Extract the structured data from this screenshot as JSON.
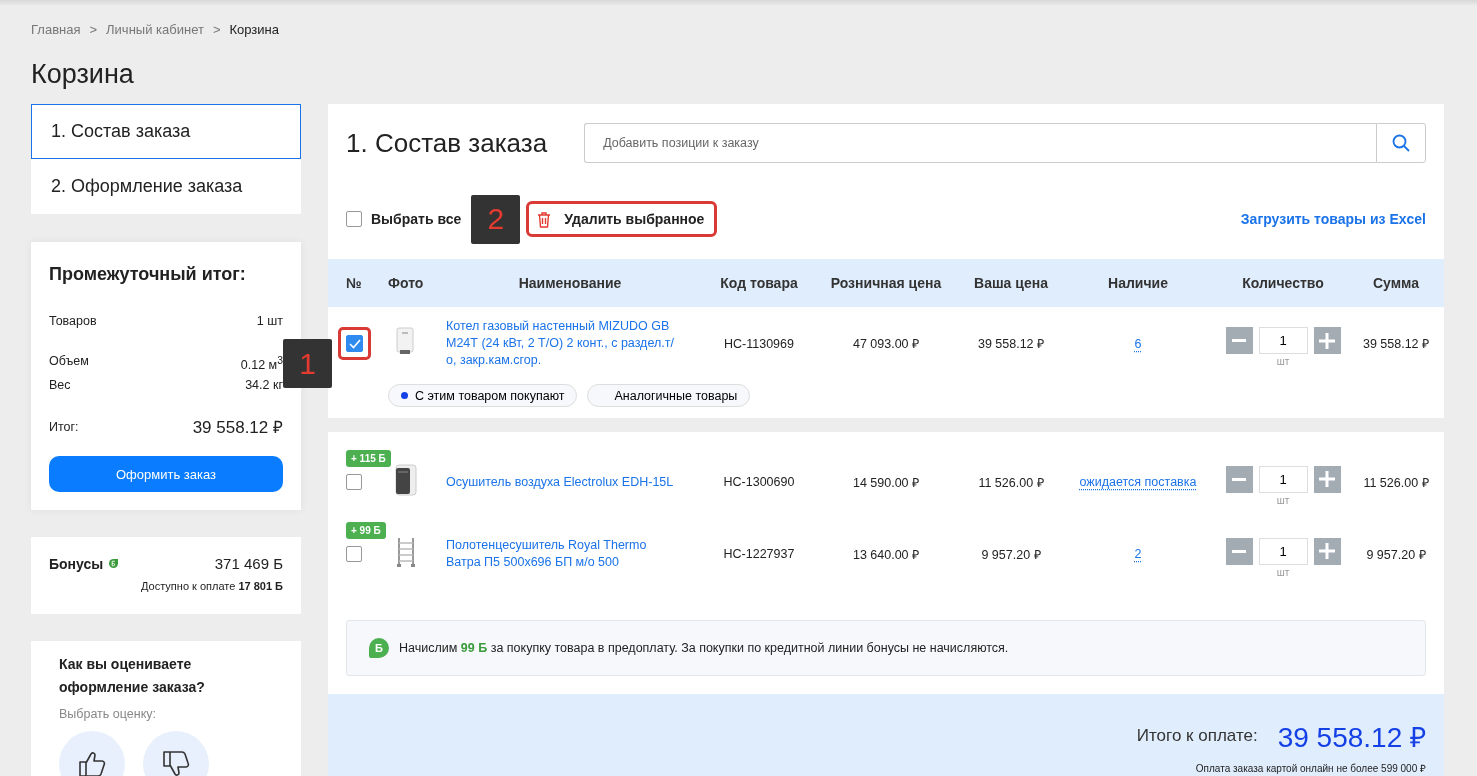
{
  "breadcrumbs": [
    {
      "label": "Главная",
      "current": false
    },
    {
      "label": "Личный кабинет",
      "current": false
    },
    {
      "label": "Корзина",
      "current": true
    }
  ],
  "breadcrumb_separator": ">",
  "page_title": "Корзина",
  "steps": [
    {
      "label": "1. Состав заказа",
      "selected": true
    },
    {
      "label": "2. Оформление заказа",
      "selected": false
    }
  ],
  "summary": {
    "title": "Промежуточный итог:",
    "groups": [
      [
        {
          "label": "Товаров",
          "value": "1 шт"
        }
      ],
      [
        {
          "label": "Объем",
          "value": "0.12 м$^{3}$"
        },
        {
          "label": "Вес",
          "value": "34.2 кг"
        }
      ]
    ],
    "total_label": "Итог:",
    "total_value": "39 558.12 ₽",
    "button": "Оформить заказ"
  },
  "bonuses": {
    "label": "Бонусы",
    "value": "371 469 Б",
    "available": "Доступно к оплате **17 801 Б**"
  },
  "rating": {
    "question": "Как вы оцениваете оформление заказа?",
    "hint": "Выбрать оценку:"
  },
  "order": {
    "title": "1. Состав заказа",
    "search": {
      "placeholder": "Добавить позиции к заказу"
    },
    "select_all": {
      "label": "Выбрать все",
      "checked": false
    },
    "delete_button": {
      "label": "Удалить выбранное",
      "highlighted": true,
      "callout": "2"
    },
    "excel_link": "Загрузить товары из Excel",
    "columns": [
      "№",
      "Фото",
      "Наименование",
      "Код товара",
      "Розничная цена",
      "Ваша цена",
      "Наличие",
      "Количество",
      "Сумма"
    ],
    "groups": [
      {
        "rows": [
          {
            "checked": true,
            "highlighted": true,
            "callout": "1",
            "name": "Котел газовый настенный MIZUDO GB М24Т (24 кВт, 2 Т/О) 2 конт., с раздел.т/о, закр.кам.сгор.",
            "code": "НС-1130969",
            "retail": "47 093.00 ₽",
            "price": "39 558.12 ₽",
            "stock": "6",
            "qty": "1",
            "unit": "шт",
            "sum": "39 558.12 ₽"
          }
        ],
        "chips": [
          {
            "label": "С этим товаром покупают",
            "selected": true
          },
          {
            "label": "Аналогичные товары",
            "selected": false
          }
        ]
      },
      {
        "rows": [
          {
            "checked": false,
            "bonus": "+ 115 Б",
            "name": "Осушитель воздуха Electrolux EDH-15L",
            "code": "НС-1300690",
            "retail": "14 590.00 ₽",
            "price": "11 526.00 ₽",
            "stock": "ожидается поставка",
            "qty": "1",
            "unit": "шт",
            "sum": "11 526.00 ₽"
          },
          {
            "checked": false,
            "bonus": "+ 99 Б",
            "name": "Полотенцесушитель Royal Thermo Ватра П5 500х696 БП м/о 500",
            "code": "НС-1227937",
            "retail": "13 640.00 ₽",
            "price": "9 957.20 ₽",
            "stock": "2",
            "qty": "1",
            "unit": "шт",
            "sum": "9 957.20 ₽"
          }
        ],
        "info": {
          "badge": "Б",
          "text": "Начислим **99 Б** за покупку товара в предоплату. За покупки по кредитной линии бонусы не начисляются."
        }
      }
    ],
    "total": {
      "label": "Итого к оплате:",
      "value": "39 558.12 ₽",
      "note": "Оплата заказа картой онлайн не более 599 000 ₽"
    }
  }
}
